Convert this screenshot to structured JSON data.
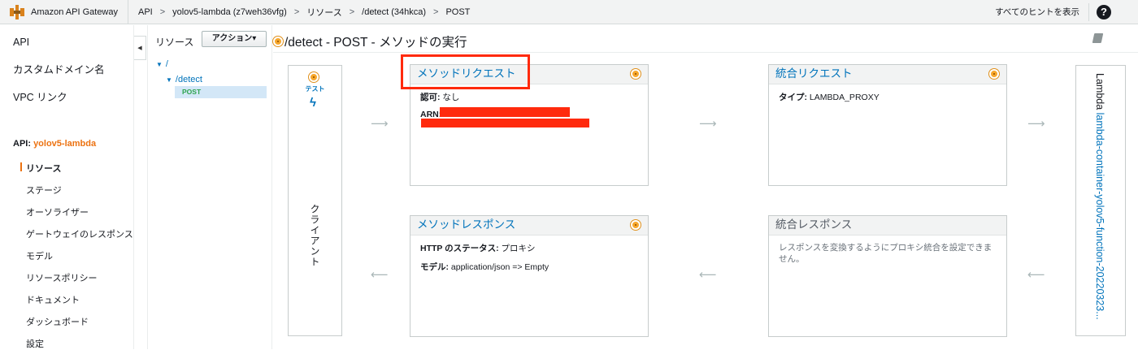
{
  "topbar": {
    "brand": "Amazon API Gateway",
    "breadcrumbs": [
      "API",
      ">",
      "yolov5-lambda (z7weh36vfg)",
      ">",
      "リソース",
      ">",
      "/detect (34hkca)",
      ">",
      "POST"
    ],
    "hints": "すべてのヒントを表示",
    "help_icon": "?"
  },
  "leftnav": {
    "top_items": [
      "API",
      "カスタムドメイン名",
      "VPC リンク"
    ],
    "api_prefix": "API: ",
    "api_name": "yolov5-lambda",
    "sub_items": [
      "リソース",
      "ステージ",
      "オーソライザー",
      "ゲートウェイのレスポンス",
      "モデル",
      "リソースポリシー",
      "ドキュメント",
      "ダッシュボード",
      "設定"
    ],
    "collapse_glyph": "◀"
  },
  "resources": {
    "header": "リソース",
    "action_button": "アクション▾",
    "root": "/",
    "child": "/detect",
    "method": "POST",
    "arrow": "▼"
  },
  "main": {
    "title": "/detect - POST - メソッドの実行",
    "client": {
      "test_label": "テスト",
      "bolt": "ϟ",
      "label": "クライアント"
    },
    "method_request": {
      "title": "メソッドリクエスト",
      "auth_label": "認可:",
      "auth_value": " なし",
      "arn_label": "ARN:"
    },
    "integration_request": {
      "title": "統合リクエスト",
      "type_label": "タイプ:",
      "type_value": " LAMBDA_PROXY"
    },
    "method_response": {
      "title": "メソッドレスポンス",
      "status_label": "HTTP のステータス:",
      "status_value": " プロキシ",
      "model_label": "モデル:",
      "model_value": " application/json => Empty"
    },
    "integration_response": {
      "title": "統合レスポンス",
      "message": "レスポンスを変換するようにプロキシ統合を設定できません。"
    },
    "lambda": {
      "prefix": "Lambda ",
      "function": "lambda-container-yolov5-function-20220323..."
    },
    "arrow_right": "⟶",
    "arrow_left": "⟵"
  },
  "colors": {
    "accent": "#ec7211",
    "link": "#0073bb",
    "redaction": "#ff2a0d",
    "dot": "#f7a72b"
  }
}
